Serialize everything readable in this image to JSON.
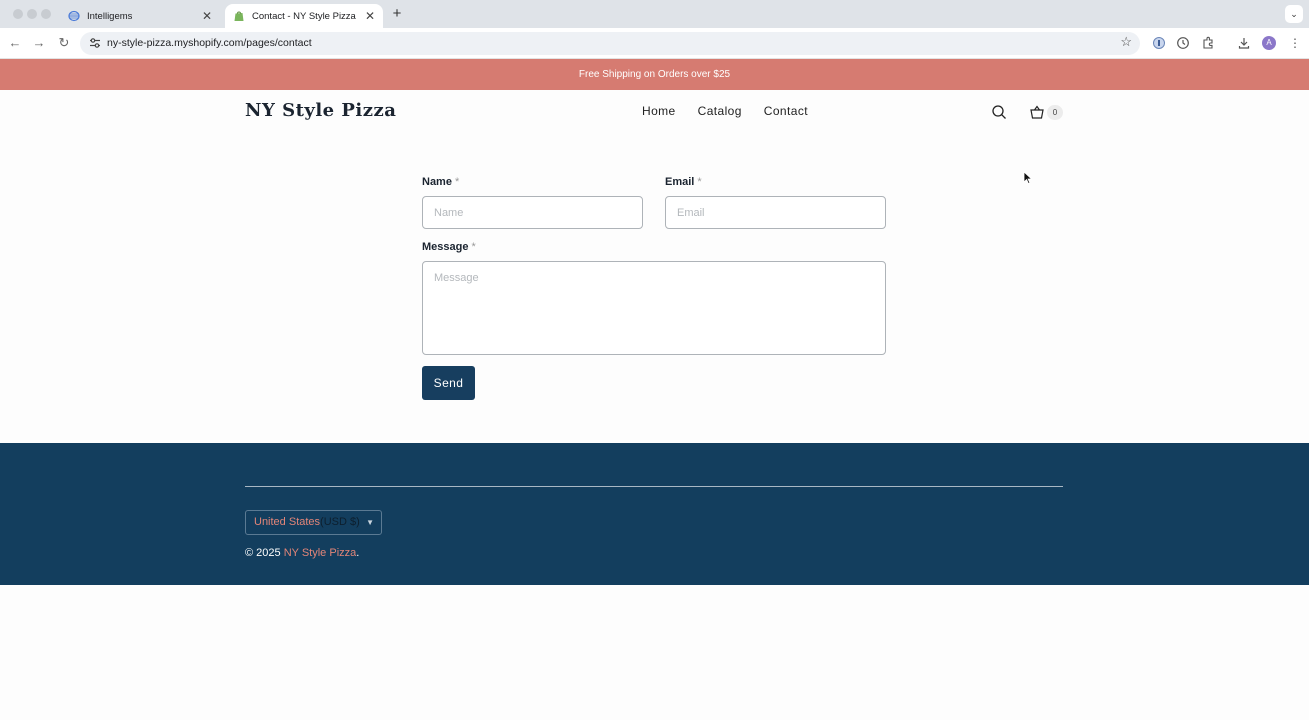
{
  "browser": {
    "tabs": [
      {
        "title": "Intelligems",
        "active": false
      },
      {
        "title": "Contact - NY Style Pizza",
        "active": true
      }
    ],
    "url": "ny-style-pizza.myshopify.com/pages/contact",
    "avatar_initial": "A"
  },
  "announcement": "Free Shipping on Orders over $25",
  "header": {
    "logo": "NY Style Pizza",
    "nav": [
      "Home",
      "Catalog",
      "Contact"
    ],
    "cart_count": "0"
  },
  "form": {
    "name_label": "Name",
    "name_placeholder": "Name",
    "email_label": "Email",
    "email_placeholder": "Email",
    "message_label": "Message",
    "message_placeholder": "Message",
    "required_mark": "*",
    "send_label": "Send"
  },
  "footer": {
    "country": "United States",
    "currency": "(USD $)",
    "copyright_prefix": "© 2025",
    "copyright_brand": "NY Style Pizza",
    "copyright_suffix": "."
  },
  "colors": {
    "announcement_bg": "#d67b71",
    "footer_bg": "#133e5e",
    "button_bg": "#173e5f",
    "accent": "#e38578"
  }
}
